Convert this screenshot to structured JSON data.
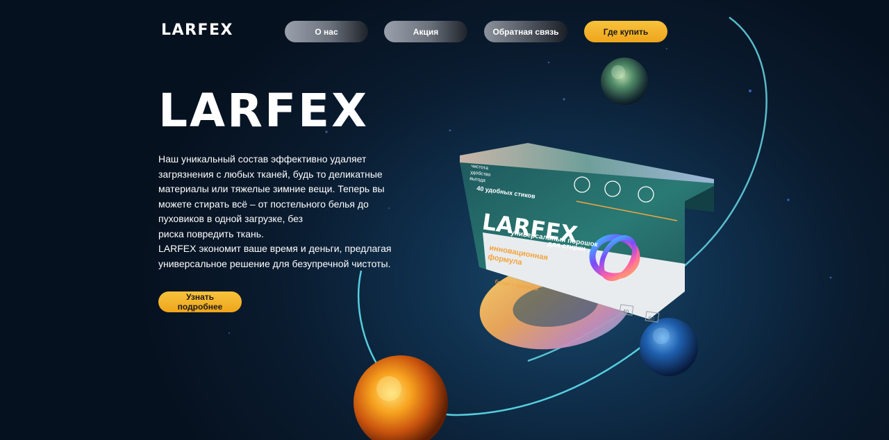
{
  "header": {
    "logo": "LARFEX",
    "nav": [
      {
        "label": "О нас"
      },
      {
        "label": "Акция"
      },
      {
        "label": "Обратная связь"
      },
      {
        "label": "Где купить"
      }
    ]
  },
  "hero": {
    "title": "LARFEX",
    "paragraph_lines": [
      "Наш уникальный состав эффективно удаляет",
      "загрязнения с любых тканей, будь то деликатные",
      "материалы или тяжелые зимние вещи. Теперь вы",
      "можете стирать всё – от постельного белья до",
      "пуховиков в одной загрузке, без",
      "риска повредить ткань.",
      "LARFEX экономит ваше время и деньги, предлагая",
      "универсальное решение для безупречной чистоты."
    ],
    "cta": "Узнать подробнее"
  },
  "product": {
    "brand": "LARFEX",
    "subtitle_line1": "универсальный порошок",
    "subtitle_line2": "для стирки",
    "sticks": "40 удобных стиков",
    "top_left_line1": "чистота",
    "top_left_line2": "удобство",
    "top_left_line3": "выгода",
    "formula_line1": "инновационная",
    "formula_line2": "формула",
    "color_note": "белое с цветным",
    "temp1": "40",
    "temp2": "60"
  },
  "colors": {
    "accent": "#f5b52a",
    "background": "#0a1c30",
    "orbit": "#5ee6f0"
  }
}
